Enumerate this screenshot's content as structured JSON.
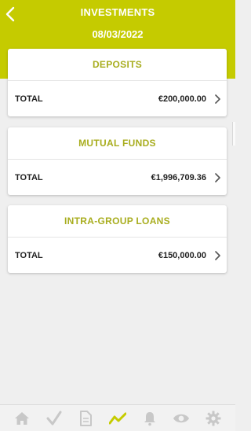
{
  "header": {
    "title": "INVESTMENTS",
    "date": "08/03/2022",
    "color": "#c5cb00"
  },
  "cards": [
    {
      "title": "DEPOSITS",
      "row_label": "TOTAL",
      "row_value": "€200,000.00"
    },
    {
      "title": "MUTUAL FUNDS",
      "row_label": "TOTAL",
      "row_value": "€1,996,709.36"
    },
    {
      "title": "INTRA-GROUP LOANS",
      "row_label": "TOTAL",
      "row_value": "€150,000.00"
    }
  ],
  "tabbar": {
    "tabs": [
      {
        "icon": "home-icon",
        "active": false
      },
      {
        "icon": "checkmark-icon",
        "active": false
      },
      {
        "icon": "document-icon",
        "active": false
      },
      {
        "icon": "trend-icon",
        "active": true
      },
      {
        "icon": "bell-icon",
        "active": false
      },
      {
        "icon": "eye-icon",
        "active": false
      },
      {
        "icon": "gear-icon",
        "active": false
      }
    ],
    "active_color": "#c5cb00",
    "inactive_color": "#c8c8c8"
  }
}
